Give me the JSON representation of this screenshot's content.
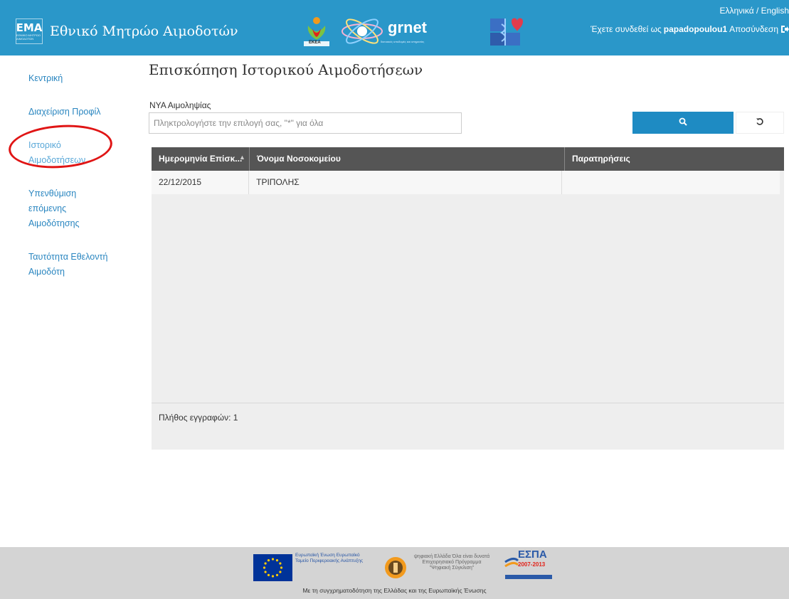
{
  "header": {
    "logo_text": "ΕΜΑ",
    "logo_subtext": "ΕΘΝΙΚΟ ΜΗΤΡΩΟ ΑΙΜΟΔΟΤΩΝ",
    "title": "Εθνικό Μητρώο Αιμοδοτών",
    "partner_ekea": "ΕΚΕΑ",
    "partner_grnet": "grnet",
    "partner_grnet_sub": "δικτυακές υποδομές και υπηρεσίες",
    "language_switch": "Ελληνικά / English",
    "logged_in_prefix": "Έχετε συνδεθεί ως",
    "username": "papadopoulou1",
    "logout_label": "Αποσύνδεση"
  },
  "sidebar": {
    "items": [
      {
        "label": "Κεντρική"
      },
      {
        "label": "Διαχείριση Προφίλ"
      },
      {
        "label": "Ιστορικό Αιμοδοτήσεων"
      },
      {
        "label": "Υπενθύμιση επόμενης Αιμοδότησης"
      },
      {
        "label": "Ταυτότητα Εθελοντή Αιμοδότη"
      }
    ]
  },
  "main": {
    "title": "Επισκόπηση Ιστορικού Αιμοδοτήσεων",
    "search": {
      "label": "ΝΥΑ Αιμοληψίας",
      "placeholder": "Πληκτρολογήστε την επιλογή σας, \"*\" για όλα",
      "value": ""
    },
    "table": {
      "columns": [
        "Ημερομηνία Επίσκ...",
        "Όνομα Νοσοκομείου",
        "Παρατηρήσεις"
      ],
      "rows": [
        {
          "date": "22/12/2015",
          "hospital": "ΤΡΙΠΟΛΗΣ",
          "notes": ""
        }
      ],
      "record_count": "Πλήθος εγγραφών: 1"
    }
  },
  "footer": {
    "eu_text": "Ευρωπαϊκή Ένωση Ευρωπαϊκό Ταμείο Περιφερειακής Ανάπτυξης",
    "digital_text": "ψηφιακή Ελλάδα Όλα είναι δυνατά Επιχειρησιακό Πρόγραμμα \"Ψηφιακή Σύγκλιση\"",
    "espa_text": "ΕΣΠΑ",
    "espa_years": "2007-2013",
    "funding_text": "Με τη συγχρηματοδότηση της Ελλάδας και της Ευρωπαϊκής Ένωσης"
  },
  "icons": {
    "search": "search-icon",
    "reset": "refresh-icon",
    "logout": "logout-icon"
  },
  "colors": {
    "header": "#2a97c9",
    "search_button": "#1e8bc3",
    "table_header": "#555555",
    "link": "#2a86c0",
    "annotation_circle": "#e01515"
  }
}
